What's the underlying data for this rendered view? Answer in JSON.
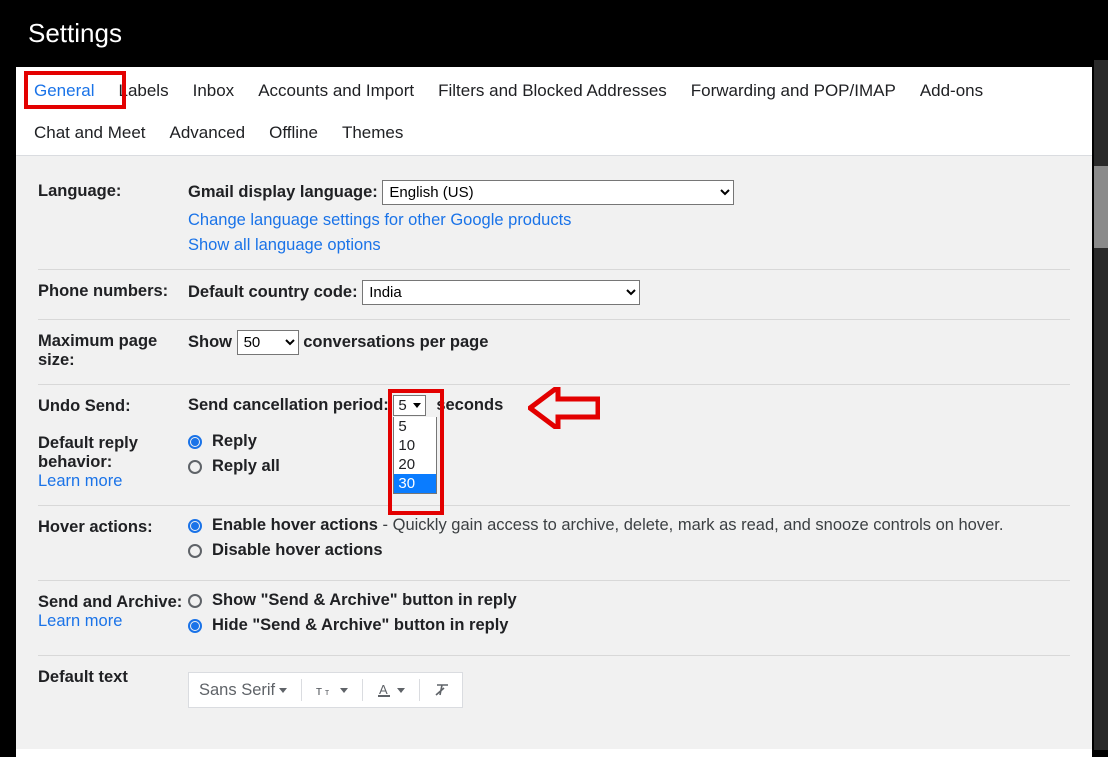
{
  "header": {
    "title": "Settings"
  },
  "tabs": {
    "row1": [
      "General",
      "Labels",
      "Inbox",
      "Accounts and Import",
      "Filters and Blocked Addresses",
      "Forwarding and POP/IMAP",
      "Add-ons"
    ],
    "row2": [
      "Chat and Meet",
      "Advanced",
      "Offline",
      "Themes"
    ],
    "active": "General"
  },
  "language": {
    "label": "Language:",
    "display_label": "Gmail display language:",
    "selected": "English (US)",
    "change_link": "Change language settings for other Google products",
    "show_all_link": "Show all language options"
  },
  "phone": {
    "label": "Phone numbers:",
    "code_label": "Default country code:",
    "selected": "India"
  },
  "pagesize": {
    "label": "Maximum page size:",
    "prefix": "Show",
    "selected": "50",
    "suffix": "conversations per page"
  },
  "undo": {
    "label": "Undo Send:",
    "period_label": "Send cancellation period:",
    "selected": "5",
    "options": [
      "5",
      "10",
      "20",
      "30"
    ],
    "highlighted": "30",
    "suffix": "seconds"
  },
  "reply": {
    "label": "Default reply behavior:",
    "learn_more": "Learn more",
    "opt1": "Reply",
    "opt2": "Reply all",
    "checked": "Reply"
  },
  "hover": {
    "label": "Hover actions:",
    "opt1": "Enable hover actions",
    "opt1_desc": " - Quickly gain access to archive, delete, mark as read, and snooze controls on hover.",
    "opt2": "Disable hover actions",
    "checked": "Enable hover actions"
  },
  "sendarchive": {
    "label": "Send and Archive:",
    "learn_more": "Learn more",
    "opt1": "Show \"Send & Archive\" button in reply",
    "opt2": "Hide \"Send & Archive\" button in reply",
    "checked": "Hide"
  },
  "defaulttext": {
    "label": "Default text",
    "font": "Sans Serif"
  }
}
